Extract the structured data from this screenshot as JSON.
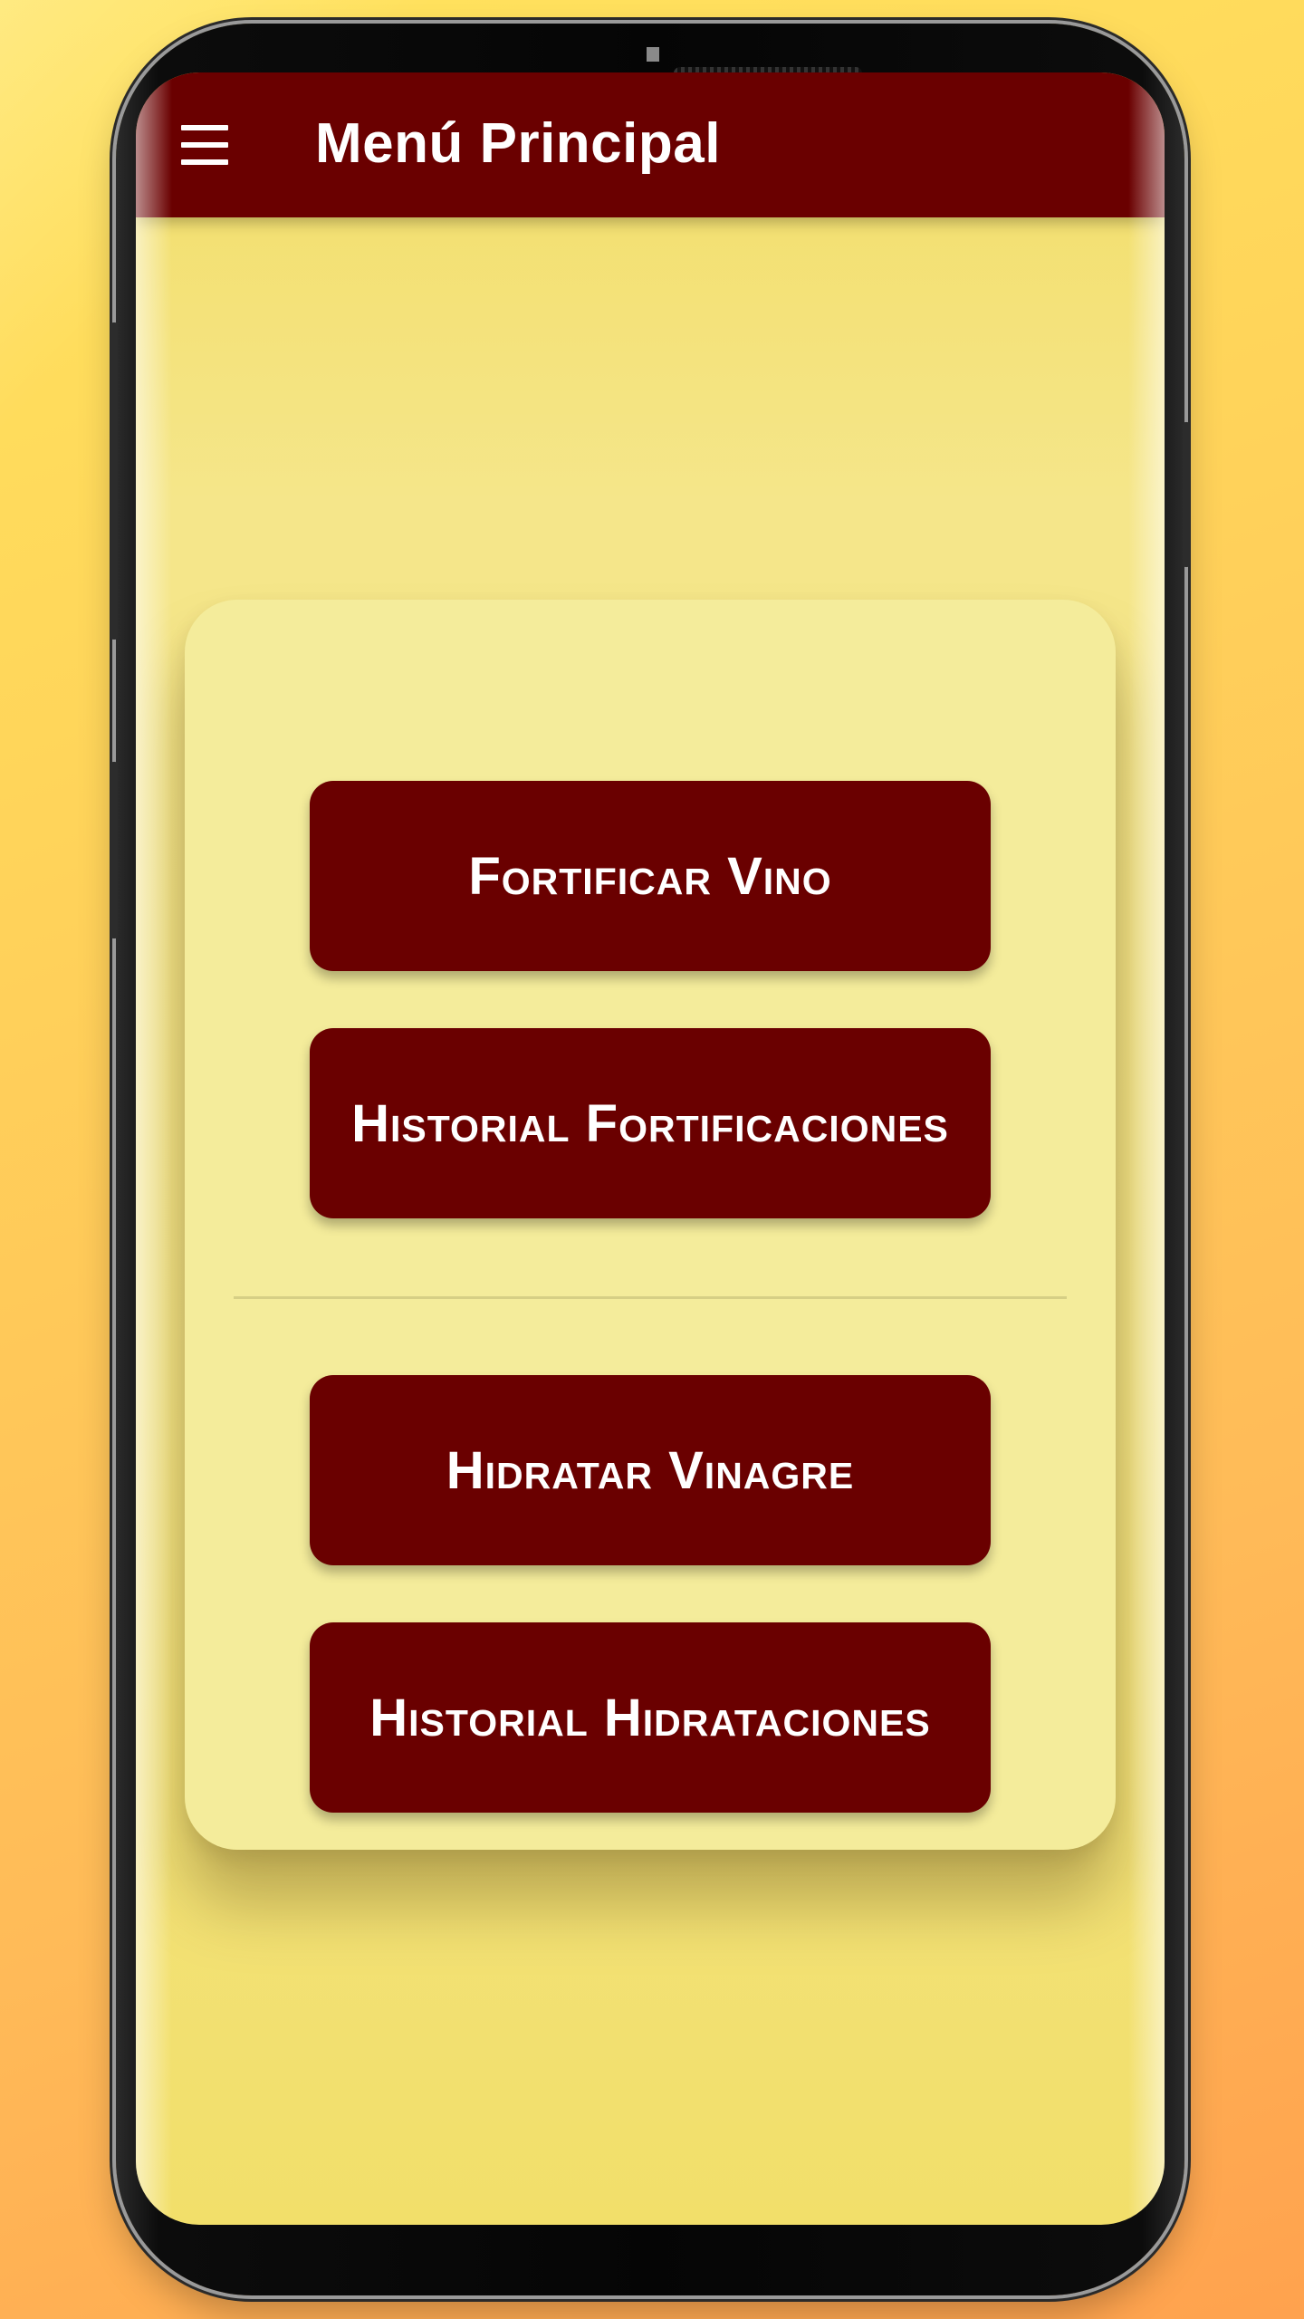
{
  "app_bar": {
    "title": "Menú Principal",
    "menu_icon": "hamburger-menu-icon"
  },
  "menu": {
    "wine_section": {
      "fortify_label": "Fortificar Vino",
      "fortify_history_label": "Historial Fortificaciones"
    },
    "vinegar_section": {
      "hydrate_label": "Hidratar Vinagre",
      "hydrate_history_label": "Historial Hidrataciones"
    }
  },
  "colors": {
    "primary": "#6a0000",
    "screen_background": "#f4e586",
    "card_background": "#f4ec9b",
    "page_background": "#ffc85a",
    "button_text": "#ffffff"
  }
}
